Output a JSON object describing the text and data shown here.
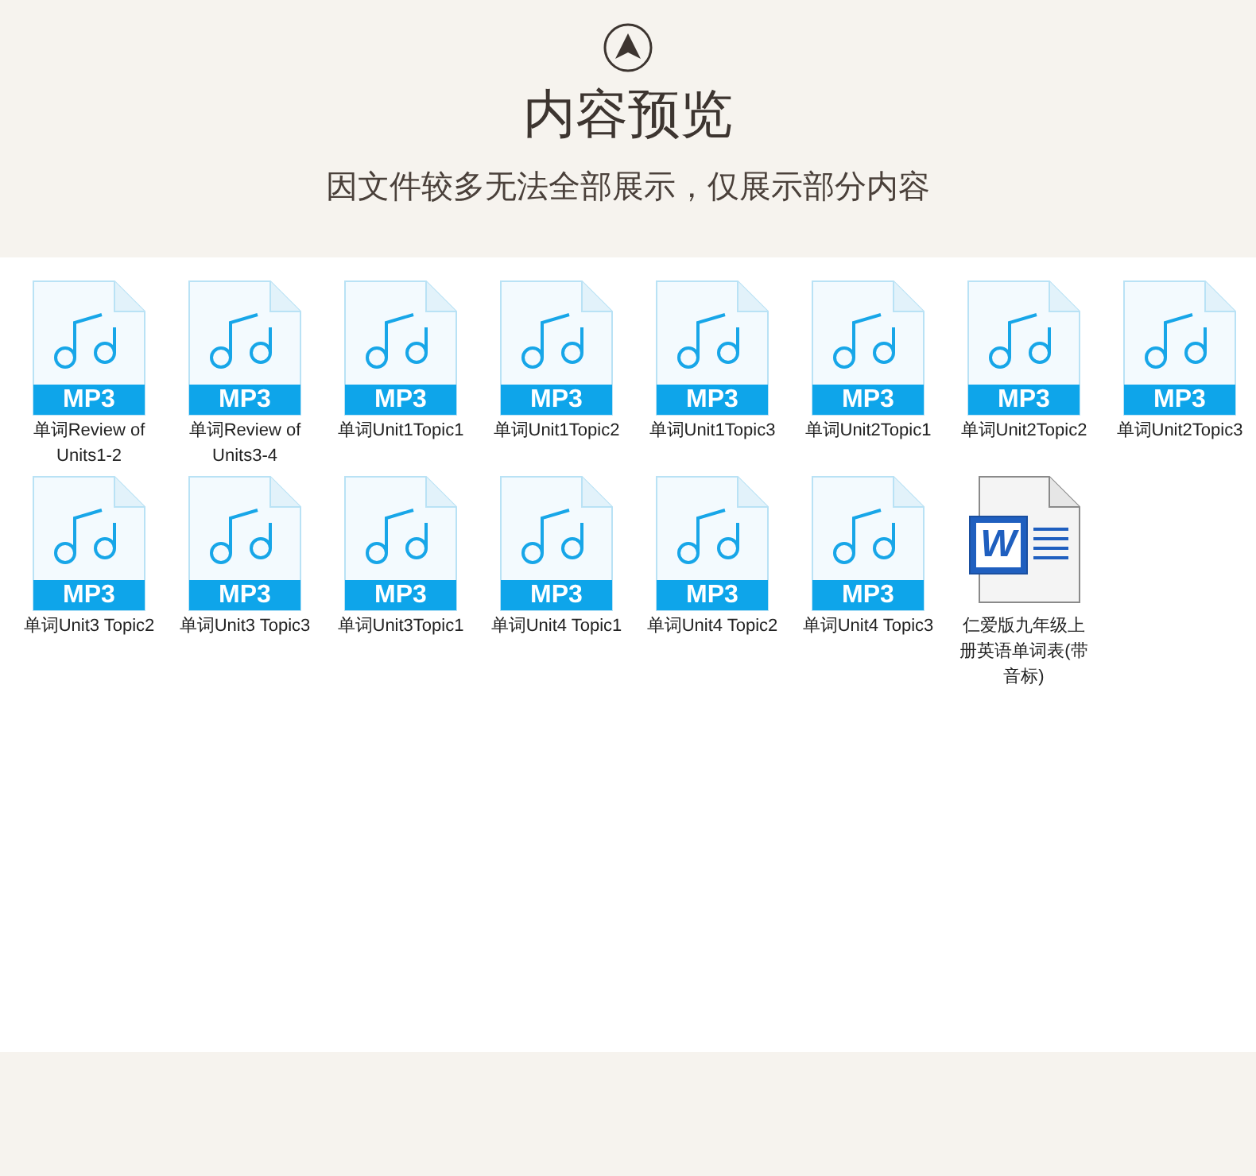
{
  "header": {
    "title": "内容预览",
    "subtitle": "因文件较多无法全部展示，仅展示部分内容"
  },
  "files": [
    {
      "kind": "mp3",
      "badge": "MP3",
      "name": "单词Review of Units1-2"
    },
    {
      "kind": "mp3",
      "badge": "MP3",
      "name": "单词Review of Units3-4"
    },
    {
      "kind": "mp3",
      "badge": "MP3",
      "name": "单词Unit1Topic1"
    },
    {
      "kind": "mp3",
      "badge": "MP3",
      "name": "单词Unit1Topic2"
    },
    {
      "kind": "mp3",
      "badge": "MP3",
      "name": "单词Unit1Topic3"
    },
    {
      "kind": "mp3",
      "badge": "MP3",
      "name": "单词Unit2Topic1"
    },
    {
      "kind": "mp3",
      "badge": "MP3",
      "name": "单词Unit2Topic2"
    },
    {
      "kind": "mp3",
      "badge": "MP3",
      "name": "单词Unit2Topic3"
    },
    {
      "kind": "mp3",
      "badge": "MP3",
      "name": "单词Unit3 Topic2"
    },
    {
      "kind": "mp3",
      "badge": "MP3",
      "name": "单词Unit3 Topic3"
    },
    {
      "kind": "mp3",
      "badge": "MP3",
      "name": "单词Unit3Topic1"
    },
    {
      "kind": "mp3",
      "badge": "MP3",
      "name": "单词Unit4 Topic1"
    },
    {
      "kind": "mp3",
      "badge": "MP3",
      "name": "单词Unit4 Topic2"
    },
    {
      "kind": "mp3",
      "badge": "MP3",
      "name": "单词Unit4 Topic3"
    },
    {
      "kind": "word",
      "badge": "W",
      "name": "仁爱版九年级上册英语单词表(带音标)"
    }
  ]
}
